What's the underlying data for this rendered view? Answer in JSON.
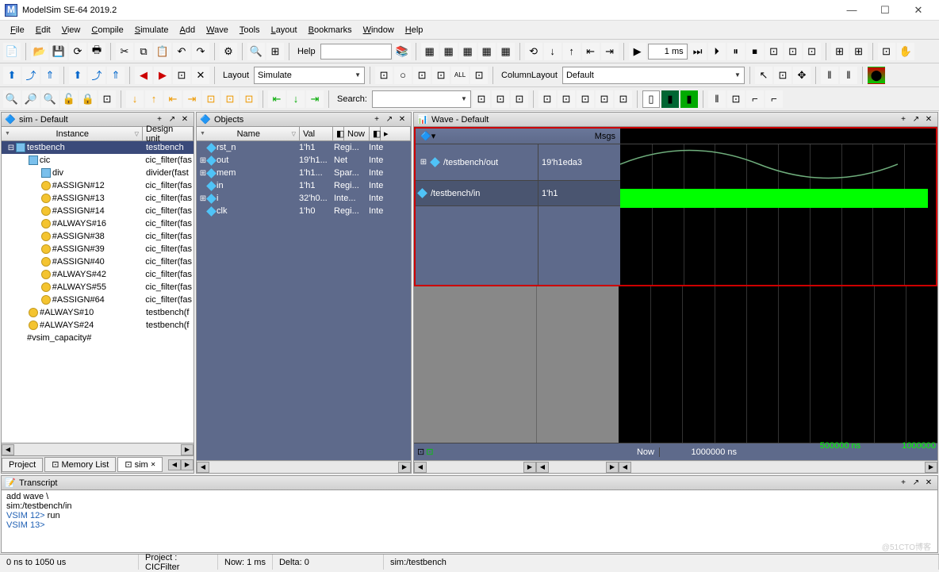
{
  "app": {
    "title": "ModelSim SE-64 2019.2"
  },
  "menu": [
    "File",
    "Edit",
    "View",
    "Compile",
    "Simulate",
    "Add",
    "Wave",
    "Tools",
    "Layout",
    "Bookmarks",
    "Window",
    "Help"
  ],
  "toolbar1": {
    "help_label": "Help",
    "time_value": "1 ms"
  },
  "toolbar2": {
    "layout_label": "Layout",
    "layout_value": "Simulate",
    "columnlayout_label": "ColumnLayout",
    "columnlayout_value": "Default"
  },
  "toolbar3": {
    "search_label": "Search:"
  },
  "sim_panel": {
    "title": "sim - Default",
    "columns": [
      "Instance",
      "Design unit"
    ],
    "tree": [
      {
        "depth": 0,
        "exp": "-",
        "icon": "box",
        "name": "testbench",
        "du": "testbench"
      },
      {
        "depth": 1,
        "exp": "-",
        "icon": "box",
        "name": "cic",
        "du": "cic_filter(fas"
      },
      {
        "depth": 2,
        "exp": "+",
        "icon": "box",
        "name": "div",
        "du": "divider(fast"
      },
      {
        "depth": 2,
        "exp": "",
        "icon": "leaf",
        "name": "#ASSIGN#12",
        "du": "cic_filter(fas"
      },
      {
        "depth": 2,
        "exp": "",
        "icon": "leaf",
        "name": "#ASSIGN#13",
        "du": "cic_filter(fas"
      },
      {
        "depth": 2,
        "exp": "",
        "icon": "leaf",
        "name": "#ASSIGN#14",
        "du": "cic_filter(fas"
      },
      {
        "depth": 2,
        "exp": "",
        "icon": "leaf",
        "name": "#ALWAYS#16",
        "du": "cic_filter(fas"
      },
      {
        "depth": 2,
        "exp": "",
        "icon": "leaf",
        "name": "#ASSIGN#38",
        "du": "cic_filter(fas"
      },
      {
        "depth": 2,
        "exp": "",
        "icon": "leaf",
        "name": "#ASSIGN#39",
        "du": "cic_filter(fas"
      },
      {
        "depth": 2,
        "exp": "",
        "icon": "leaf",
        "name": "#ASSIGN#40",
        "du": "cic_filter(fas"
      },
      {
        "depth": 2,
        "exp": "",
        "icon": "leaf",
        "name": "#ALWAYS#42",
        "du": "cic_filter(fas"
      },
      {
        "depth": 2,
        "exp": "",
        "icon": "leaf",
        "name": "#ALWAYS#55",
        "du": "cic_filter(fas"
      },
      {
        "depth": 2,
        "exp": "",
        "icon": "leaf",
        "name": "#ASSIGN#64",
        "du": "cic_filter(fas"
      },
      {
        "depth": 1,
        "exp": "",
        "icon": "leaf",
        "name": "#ALWAYS#10",
        "du": "testbench(f"
      },
      {
        "depth": 1,
        "exp": "",
        "icon": "leaf",
        "name": "#ALWAYS#24",
        "du": "testbench(f"
      },
      {
        "depth": 0,
        "exp": "",
        "icon": "cap",
        "name": "#vsim_capacity#",
        "du": ""
      }
    ],
    "tabs": [
      "Project",
      "Memory List",
      "sim"
    ]
  },
  "objects_panel": {
    "title": "Objects",
    "columns": [
      "Name",
      "Val",
      "",
      "Now",
      "",
      ""
    ],
    "rows": [
      {
        "exp": "",
        "name": "rst_n",
        "val": "1'h1",
        "kind": "Regi...",
        "mode": "Inte"
      },
      {
        "exp": "+",
        "name": "out",
        "val": "19'h1...",
        "kind": "Net",
        "mode": "Inte"
      },
      {
        "exp": "+",
        "name": "mem",
        "val": "1'h1...",
        "kind": "Spar...",
        "mode": "Inte"
      },
      {
        "exp": "",
        "name": "in",
        "val": "1'h1",
        "kind": "Regi...",
        "mode": "Inte"
      },
      {
        "exp": "+",
        "name": "i",
        "val": "32'h0...",
        "kind": "Inte...",
        "mode": "Inte"
      },
      {
        "exp": "",
        "name": "clk",
        "val": "1'h0",
        "kind": "Regi...",
        "mode": "Inte"
      }
    ]
  },
  "wave_panel": {
    "title": "Wave - Default",
    "msgs_label": "Msgs",
    "signals": [
      {
        "exp": "+",
        "name": "/testbench/out",
        "val": "19'h1eda3"
      },
      {
        "exp": "",
        "name": "/testbench/in",
        "val": "1'h1",
        "sel": true
      }
    ],
    "now_label": "Now",
    "now_time": "1000000 ns",
    "ruler": [
      "500000 ns",
      "1000000 "
    ]
  },
  "transcript": {
    "title": "Transcript",
    "lines": [
      {
        "prompt": "",
        "text": "add wave  \\"
      },
      {
        "prompt": "",
        "text": "sim:/testbench/in"
      },
      {
        "prompt": "VSIM 12> ",
        "text": "run"
      },
      {
        "prompt": "",
        "text": ""
      },
      {
        "prompt": "VSIM 13>",
        "text": ""
      }
    ]
  },
  "statusbar": {
    "range": "0 ns to 1050 us",
    "project": "Project : CICFilter",
    "now": "Now: 1 ms",
    "delta": "Delta: 0",
    "context": "sim:/testbench"
  },
  "watermark": "@51CTO博客"
}
